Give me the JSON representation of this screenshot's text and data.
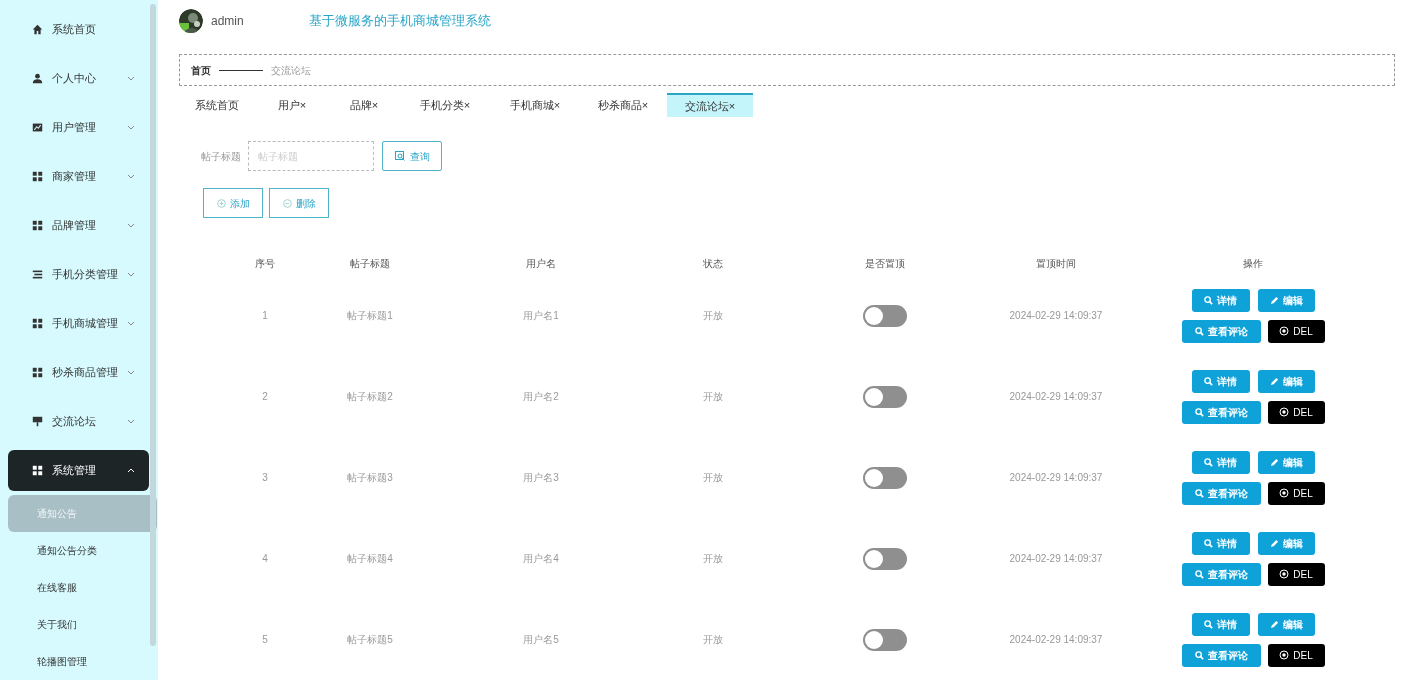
{
  "sidebar": {
    "items": [
      {
        "label": "系统首页",
        "kind": "home",
        "expandable": false,
        "expanded": false
      },
      {
        "label": "个人中心",
        "kind": "user",
        "expandable": true,
        "expanded": false
      },
      {
        "label": "用户管理",
        "kind": "chart",
        "expandable": true,
        "expanded": false
      },
      {
        "label": "商家管理",
        "kind": "grid",
        "expandable": true,
        "expanded": false
      },
      {
        "label": "品牌管理",
        "kind": "grid",
        "expandable": true,
        "expanded": false
      },
      {
        "label": "手机分类管理",
        "kind": "list",
        "expandable": true,
        "expanded": false
      },
      {
        "label": "手机商城管理",
        "kind": "grid",
        "expandable": true,
        "expanded": false
      },
      {
        "label": "秒杀商品管理",
        "kind": "grid",
        "expandable": true,
        "expanded": false
      },
      {
        "label": "交流论坛",
        "kind": "sign",
        "expandable": true,
        "expanded": false
      },
      {
        "label": "系统管理",
        "kind": "grid",
        "expandable": true,
        "expanded": true,
        "children": [
          {
            "label": "通知公告",
            "selected": true
          },
          {
            "label": "通知公告分类",
            "selected": false
          },
          {
            "label": "在线客服",
            "selected": false
          },
          {
            "label": "关于我们",
            "selected": false
          },
          {
            "label": "轮播图管理",
            "selected": false
          }
        ]
      }
    ]
  },
  "header": {
    "user": "admin",
    "title": "基于微服务的手机商城管理系统"
  },
  "breadcrumb": [
    "首页",
    "交流论坛"
  ],
  "tabs": [
    {
      "label": "系统首页",
      "closable": false,
      "selected": false
    },
    {
      "label": "用户",
      "closable": true,
      "selected": false
    },
    {
      "label": "品牌",
      "closable": true,
      "selected": false
    },
    {
      "label": "手机分类",
      "closable": true,
      "selected": false
    },
    {
      "label": "手机商城",
      "closable": true,
      "selected": false
    },
    {
      "label": "秒杀商品",
      "closable": true,
      "selected": false
    },
    {
      "label": "交流论坛",
      "closable": true,
      "selected": true
    }
  ],
  "close_glyph": "×",
  "search": {
    "label": "帖子标题",
    "placeholder": "帖子标题",
    "button": "查询"
  },
  "toolbar": {
    "add": "添加",
    "delete": "删除"
  },
  "table": {
    "columns": [
      "序号",
      "帖子标题",
      "用户名",
      "状态",
      "是否置顶",
      "置顶时间",
      "操作"
    ],
    "rows": [
      {
        "index": "1",
        "title": "帖子标题1",
        "user": "用户名1",
        "status": "开放",
        "pinned": false,
        "time": "2024-02-29 14:09:37",
        "actions": [
          "详情",
          "编辑",
          "查看评论",
          "DEL"
        ]
      },
      {
        "index": "2",
        "title": "帖子标题2",
        "user": "用户名2",
        "status": "开放",
        "pinned": false,
        "time": "2024-02-29 14:09:37",
        "actions": [
          "详情",
          "编辑",
          "查看评论",
          "DEL"
        ]
      },
      {
        "index": "3",
        "title": "帖子标题3",
        "user": "用户名3",
        "status": "开放",
        "pinned": false,
        "time": "2024-02-29 14:09:37",
        "actions": [
          "详情",
          "编辑",
          "查看评论",
          "DEL"
        ]
      },
      {
        "index": "4",
        "title": "帖子标题4",
        "user": "用户名4",
        "status": "开放",
        "pinned": false,
        "time": "2024-02-29 14:09:37",
        "actions": [
          "详情",
          "编辑",
          "查看评论",
          "DEL"
        ]
      },
      {
        "index": "5",
        "title": "帖子标题5",
        "user": "用户名5",
        "status": "开放",
        "pinned": false,
        "time": "2024-02-29 14:09:37",
        "actions": [
          "详情",
          "编辑",
          "查看评论",
          "DEL"
        ]
      }
    ]
  }
}
